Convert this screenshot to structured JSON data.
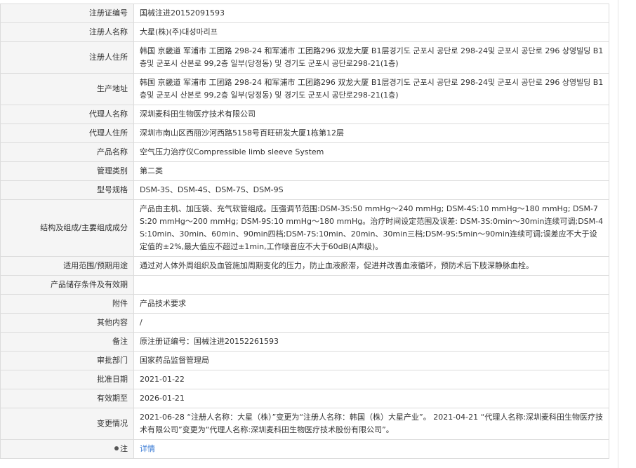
{
  "rows": [
    {
      "label": "注册证编号",
      "value": "国械注进20152091593"
    },
    {
      "label": "注册人名称",
      "value": "大星(株)(주)대성마리프"
    },
    {
      "label": "注册人住所",
      "value": "韩国 京畿道 军浦市 工团路 298-24 和军浦市 工团路296 双龙大厦 B1层경기도 군포시 공단로 298-24및 군포시 공단로 296 상영빌딩 B1층및 군포시 산본로 99,2층 일부(당정동) 및 경기도 군포시 공단로298-21(1층)"
    },
    {
      "label": "生产地址",
      "value": "韩国 京畿道 军浦市 工团路 298-24 和军浦市 工团路296 双龙大厦 B1层경기도 군포시 공단로 298-24및 군포시 공단로 296 상영빌딩 B1층및 군포시 산본로 99,2층 일부(당정동) 및 경기도 군포시 공단로298-21(1층)"
    },
    {
      "label": "代理人名称",
      "value": "深圳麦科田生物医疗技术有限公司"
    },
    {
      "label": "代理人住所",
      "value": "深圳市南山区西丽沙河西路5158号百旺研发大厦1栋第12层"
    },
    {
      "label": "产品名称",
      "value": "空气压力治疗仪Compressible limb sleeve System"
    },
    {
      "label": "管理类别",
      "value": "第二类"
    },
    {
      "label": "型号规格",
      "value": "DSM-3S、DSM-4S、DSM-7S、DSM-9S"
    },
    {
      "label": "结构及组成/主要组成成分",
      "value": "产品由主机、加压袋、充气软管组成。压强调节范围:DSM-3S:50 mmHg～240 mmHg; DSM-4S:10 mmHg～180 mmHg; DSM-7S:20 mmHg～200 mmHg; DSM-9S:10 mmHg～180 mmHg。治疗时间设定范围及误差: DSM-3S:0min～30min连续可调;DSM-4S:10min、30min、60min、90min四档;DSM-7S:10min、20min、30min三档;DSM-9S:5min～90min连续可调;误差应不大于设定值的±2%,最大值应不超过±1min,工作噪音应不大于60dB(A声级)。"
    },
    {
      "label": "适用范围/预期用途",
      "value": "通过对人体外周组织及血管施加周期变化的压力，防止血液瘀滞，促进并改善血液循环，预防术后下肢深静脉血栓。"
    },
    {
      "label": "产品储存条件及有效期",
      "value": ""
    },
    {
      "label": "附件",
      "value": "产品技术要求"
    },
    {
      "label": "其他内容",
      "value": "/"
    },
    {
      "label": "备注",
      "value": "原注册证编号：国械注进20152261593"
    },
    {
      "label": "审批部门",
      "value": "国家药品监督管理局"
    },
    {
      "label": "批准日期",
      "value": "2021-01-22"
    },
    {
      "label": "有效期至",
      "value": "2026-01-21"
    },
    {
      "label": "变更情况",
      "value": "2021-06-28 “注册人名称：大星（株）”变更为“注册人名称：韩国（株）大星产业”。 2021-04-21 “代理人名称:深圳麦科田生物医疗技术有限公司”变更为“代理人名称:深圳麦科田生物医疗技术股份有限公司”。"
    }
  ],
  "note": {
    "label": "注",
    "link_text": "详情",
    "icon": "pin-icon"
  },
  "colors": {
    "label_bg": "#f5f5f5",
    "border": "#dcdcdc",
    "link": "#3a7bd5"
  }
}
